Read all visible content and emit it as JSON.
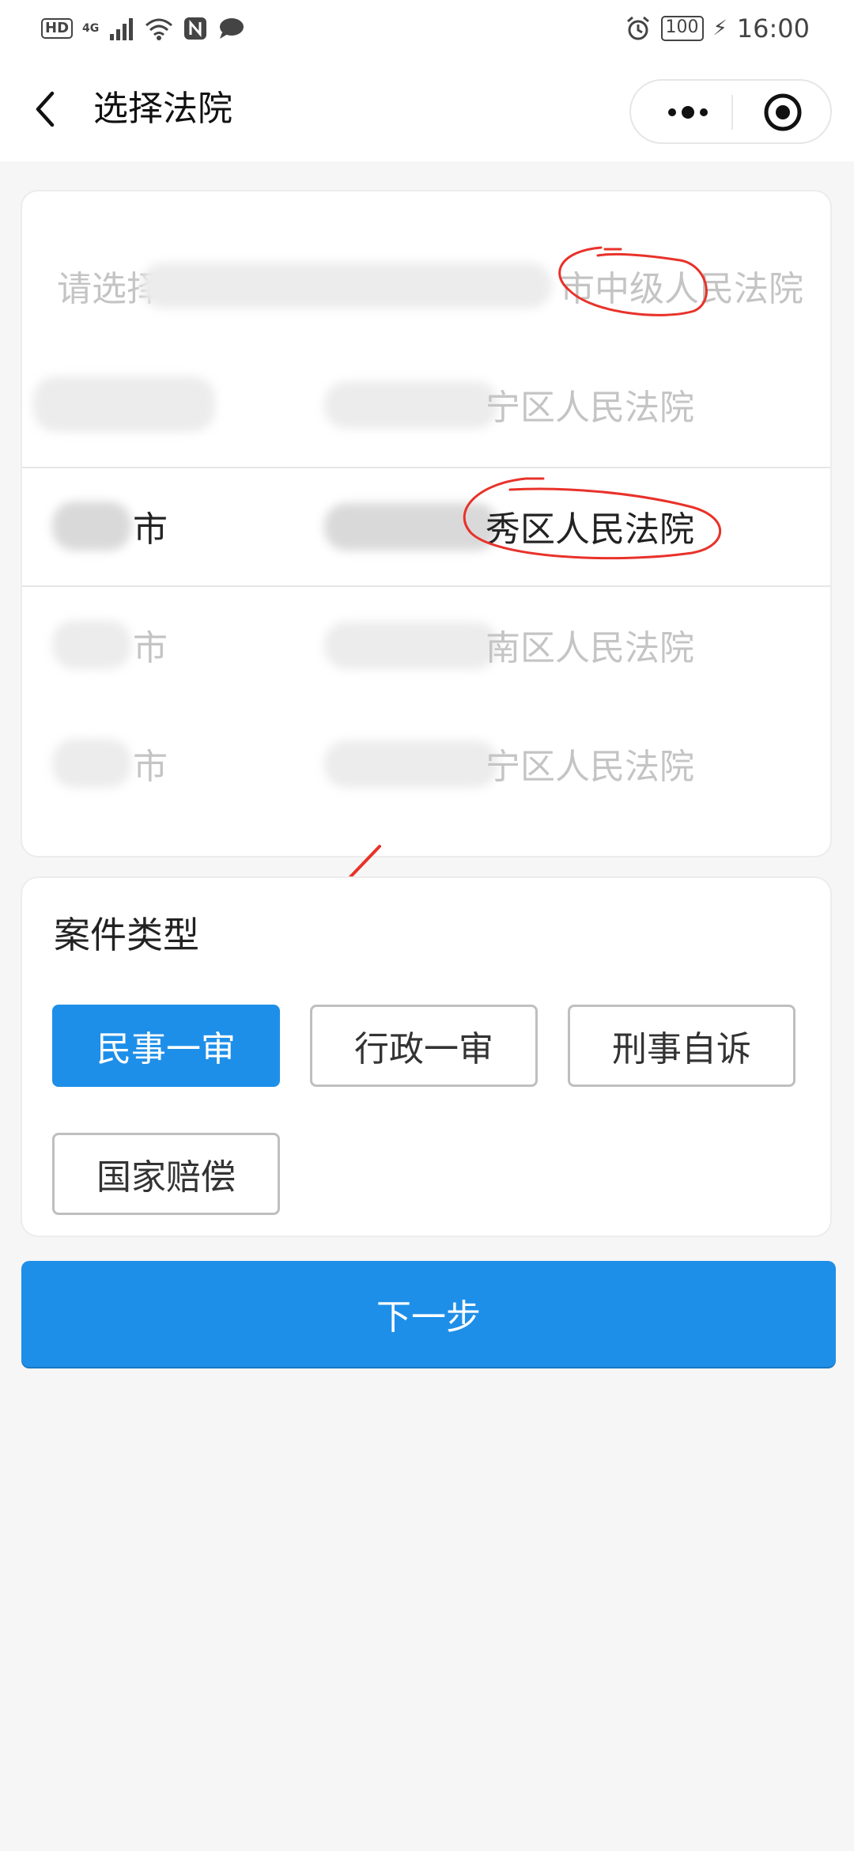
{
  "status_bar": {
    "hd": "HD",
    "network": "4G",
    "battery": "100",
    "time": "16:00"
  },
  "header": {
    "title": "选择法院"
  },
  "picker": {
    "header_label": "请选择",
    "rows": [
      {
        "city": "",
        "court": "市中级人民法院",
        "state": "faded"
      },
      {
        "city": "",
        "court": "宁区人民法院",
        "state": "faded"
      },
      {
        "city": "市",
        "court": "秀区人民法院",
        "state": "selected"
      },
      {
        "city": "市",
        "court": "南区人民法院",
        "state": "faded"
      },
      {
        "city": "市",
        "court": "宁区人民法院",
        "state": "faded"
      }
    ]
  },
  "case_type": {
    "title": "案件类型",
    "options": [
      {
        "label": "民事一审",
        "selected": true
      },
      {
        "label": "行政一审",
        "selected": false
      },
      {
        "label": "刑事自诉",
        "selected": false
      },
      {
        "label": "国家赔偿",
        "selected": false
      }
    ]
  },
  "next_button": "下一步",
  "colors": {
    "accent": "#1e8fe8",
    "annotation": "#e8322a",
    "faded_text": "#c4c4c4"
  },
  "icons": [
    "back-arrow-icon",
    "more-dots-icon",
    "target-icon",
    "alarm-icon",
    "signal-icon",
    "wifi-icon",
    "nfc-icon",
    "chat-icon",
    "bolt-icon"
  ]
}
